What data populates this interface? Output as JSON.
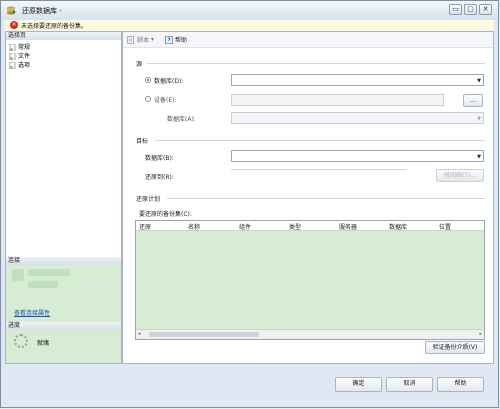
{
  "window": {
    "title": "还原数据库 -",
    "buttons": [
      "▭",
      "▢",
      "✕"
    ]
  },
  "error": {
    "message": "未选择要还原的备份集。"
  },
  "left_panel": {
    "select_page_header": "选择页",
    "pages": [
      {
        "label": "常规",
        "icon": "page-icon"
      },
      {
        "label": "文件",
        "icon": "page-icon"
      },
      {
        "label": "选项",
        "icon": "page-icon"
      }
    ],
    "connection_header": "连接",
    "view_connection_link": "查看连接属性",
    "progress_header": "进度",
    "progress_status": "就绪"
  },
  "toolbar": {
    "script_label": "脚本",
    "script_arrow": "▾",
    "help_label": "帮助"
  },
  "source": {
    "section_label": "源",
    "database_radio_label": "数据库(D):",
    "device_radio_label": "设备(E):",
    "browse_button": "...",
    "device_database_label": "数据库(A):"
  },
  "target": {
    "section_label": "目标",
    "database_label": "数据库(B):",
    "restore_to_label": "还原到(R):",
    "timeline_button": "时间线(T)..."
  },
  "plan": {
    "section_label": "还原计划",
    "backup_sets_label": "要还原的备份集(C):",
    "columns": [
      "还原",
      "名称",
      "组件",
      "类型",
      "服务器",
      "数据库",
      "位置"
    ],
    "verify_button": "验证备份介质(V)"
  },
  "footer": {
    "ok": "确定",
    "cancel": "取消",
    "help": "帮助"
  },
  "colors": {
    "error_bg": "#fffbe0",
    "panel_green": "#d6ecd3",
    "link": "#1f4fbf"
  }
}
